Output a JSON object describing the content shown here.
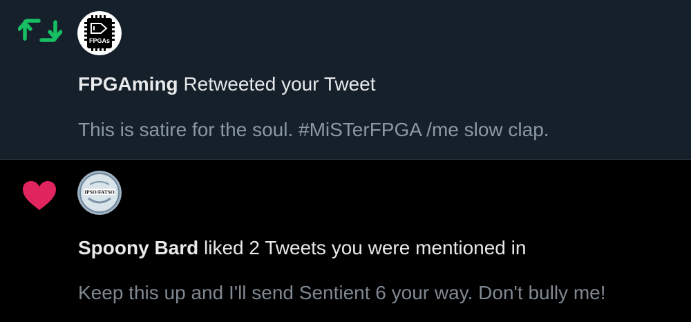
{
  "notifications": [
    {
      "type": "retweet",
      "avatar_label": "FPGAs",
      "user": "FPGAming",
      "action": " Retweeted your Tweet",
      "snippet": "This is satire for the soul. #MiSTerFPGA /me slow clap.",
      "colors": {
        "icon": "#17bf63",
        "background": "#15202b"
      }
    },
    {
      "type": "like",
      "avatar_label": "IPSO/FATSO",
      "user": "Spoony Bard",
      "action": " liked 2 Tweets you were mentioned in",
      "snippet": "Keep this up and I'll send Sentient 6 your way. Don't bully me!",
      "colors": {
        "icon": "#e0245e",
        "background": "#000000"
      }
    }
  ]
}
